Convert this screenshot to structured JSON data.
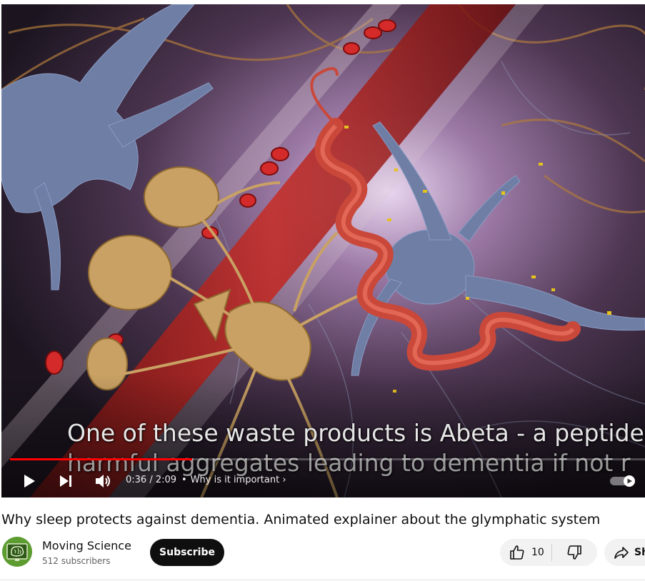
{
  "player": {
    "caption_line1": "One of these waste products is Abeta - a peptide",
    "caption_line2": "harmful aggregates leading to dementia if not r",
    "progress_fraction": 0.287,
    "current_time": "0:36",
    "duration": "2:09",
    "time_display": "0:36 / 2:09",
    "chapter_separator": "•",
    "chapter_title": "Why is it important",
    "chapter_chevron": "›",
    "icons": {
      "play": "play-icon",
      "next": "next-icon",
      "volume": "volume-icon",
      "autoplay": "autoplay-toggle-icon"
    }
  },
  "video": {
    "title": "Why sleep protects against dementia. Animated explainer about the glymphatic system"
  },
  "channel": {
    "name": "Moving Science",
    "subscribers": "512 subscribers",
    "subscribe_label": "Subscribe"
  },
  "actions": {
    "like_count": "10",
    "share_label": "Sh"
  },
  "colors": {
    "progress": "#ff0000",
    "subscribe_bg": "#0f0f0f",
    "pill_bg": "#f2f2f2"
  }
}
